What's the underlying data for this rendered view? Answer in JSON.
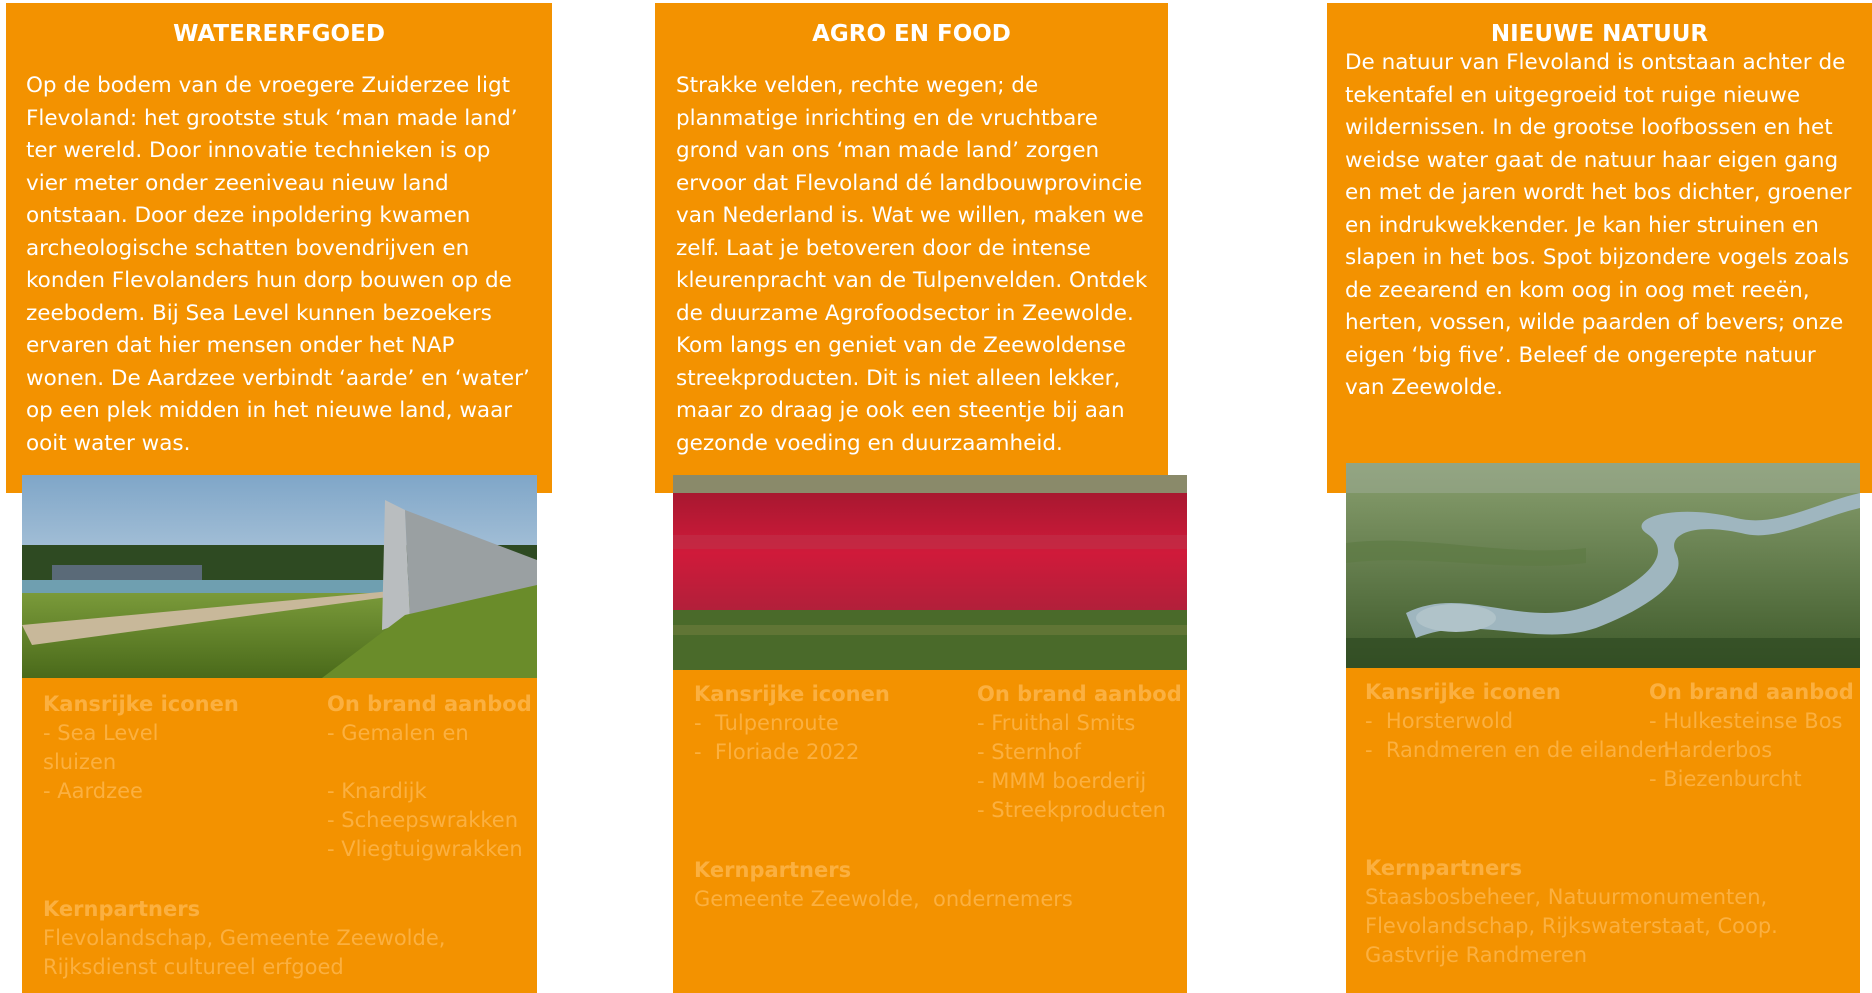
{
  "cards": [
    {
      "title": "WATERERFGOED",
      "text": "Op de bodem van de vroegere Zuiderzee ligt Flevoland: het grootste stuk ‘man made land’ ter wereld. Door innovatie technieken is op vier meter onder zeeniveau nieuw land ontstaan. Door deze inpoldering kwamen archeologische schatten bovendrijven en konden Flevolanders hun dorp bouwen op de zeebodem. Bij Sea Level  kunnen bezoekers ervaren dat hier mensen onder het NAP wonen. De Aardzee verbindt ‘aarde’ en ‘water’ op een plek midden in het nieuwe land, waar ooit water was.",
      "kansrijke_heading": "Kansrijke iconen",
      "kansrijke": [
        "- Sea Level",
        "sluizen",
        "- Aardzee"
      ],
      "onbrand_heading": "On brand aanbod",
      "onbrand": [
        "- Gemalen en",
        "",
        "- Knardijk",
        "- Scheepswrakken",
        "- Vliegtuigwrakken"
      ],
      "kern_heading": "Kernpartners",
      "kern": [
        "Flevolandschap, Gemeente Zeewolde,",
        "Rijksdienst cultureel erfgoed"
      ],
      "photo_icon": "landscape-monument-photo"
    },
    {
      "title": "AGRO EN FOOD",
      "text": "Strakke velden, rechte wegen; de planmatige inrichting en de vruchtbare grond van ons ‘man made land’ zorgen ervoor dat Flevoland dé landbouwprovincie van Nederland is. Wat we willen, maken we zelf. Laat je betoveren door de intense kleurenpracht van de Tulpenvelden. Ontdek de duurzame Agrofoodsector in Zeewolde. Kom langs en geniet van de Zeewoldense streekproducten. Dit is niet alleen lekker, maar zo draag je ook een steentje bij aan gezonde voeding en duurzaamheid.",
      "kansrijke_heading": "Kansrijke iconen",
      "kansrijke": [
        "-  Tulpenroute",
        "-  Floriade 2022"
      ],
      "onbrand_heading": "On brand aanbod",
      "onbrand": [
        "- Fruithal Smits",
        "- Sternhof",
        "- MMM boerderij",
        "- Streekproducten"
      ],
      "kern_heading": "Kernpartners",
      "kern": [
        "Gemeente Zeewolde,  ondernemers"
      ],
      "photo_icon": "tulip-field-photo"
    },
    {
      "title": "NIEUWE NATUUR",
      "text": "De natuur van Flevoland is ontstaan achter de tekentafel en uitgegroeid tot ruige nieuwe wildernissen. In de grootse loofbossen en het weidse water gaat de natuur haar eigen gang en met de jaren wordt het bos dichter, groener en indrukwekkender. Je kan hier struinen en slapen in het bos. Spot bijzondere vogels zoals de zeearend en kom oog in oog met reeën, herten, vossen, wilde paarden of bevers; onze eigen ‘big five’. Beleef de ongerepte natuur van Zeewolde.",
      "kansrijke_heading": "Kansrijke iconen",
      "kansrijke": [
        "-  Horsterwold",
        "-  Randmeren en de eilanden"
      ],
      "onbrand_heading": "On brand aanbod",
      "onbrand": [
        "- Hulkesteinse Bos",
        "- Harderbos",
        "- Biezenburcht"
      ],
      "kern_heading": "Kernpartners",
      "kern": [
        "Staasbosbeheer, Natuurmonumenten,",
        "Flevolandschap, Rijkswaterstaat, Coop.",
        "Gastvrije Randmeren"
      ],
      "photo_icon": "aerial-nature-photo"
    }
  ],
  "colors": {
    "orange": "#F39200",
    "faded_text": "#FBB040",
    "white": "#FFFFFF"
  }
}
